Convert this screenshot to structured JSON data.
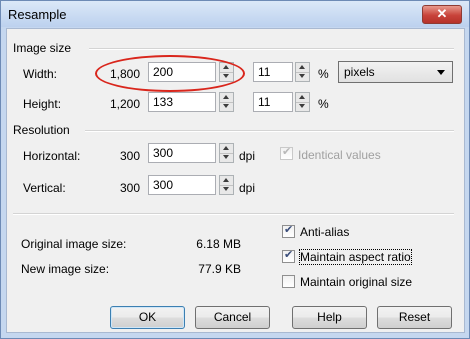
{
  "window": {
    "title": "Resample",
    "close_glyph": "✕"
  },
  "image_size": {
    "section_label": "Image size",
    "width": {
      "label": "Width:",
      "original": "1,800",
      "value": "200",
      "percent": "11",
      "percent_sign": "%"
    },
    "height": {
      "label": "Height:",
      "original": "1,200",
      "value": "133",
      "percent": "11",
      "percent_sign": "%"
    },
    "unit": "pixels"
  },
  "resolution": {
    "section_label": "Resolution",
    "horizontal": {
      "label": "Horizontal:",
      "original": "300",
      "value": "300",
      "unit": "dpi"
    },
    "vertical": {
      "label": "Vertical:",
      "original": "300",
      "value": "300",
      "unit": "dpi"
    },
    "identical_values": {
      "label": "Identical values",
      "checked": true,
      "enabled": false
    }
  },
  "info": {
    "original_label": "Original image size:",
    "original_value": "6.18 MB",
    "new_label": "New image size:",
    "new_value": "77.9 KB"
  },
  "options": {
    "anti_alias": {
      "label": "Anti-alias",
      "checked": true
    },
    "maintain_aspect": {
      "label": "Maintain aspect ratio",
      "checked": true
    },
    "maintain_original": {
      "label": "Maintain original size",
      "checked": false
    }
  },
  "buttons": {
    "ok": "OK",
    "cancel": "Cancel",
    "help": "Help",
    "reset": "Reset"
  },
  "colors": {
    "annotation": "#d9261c",
    "title_gradient": "#c5d7ef"
  }
}
